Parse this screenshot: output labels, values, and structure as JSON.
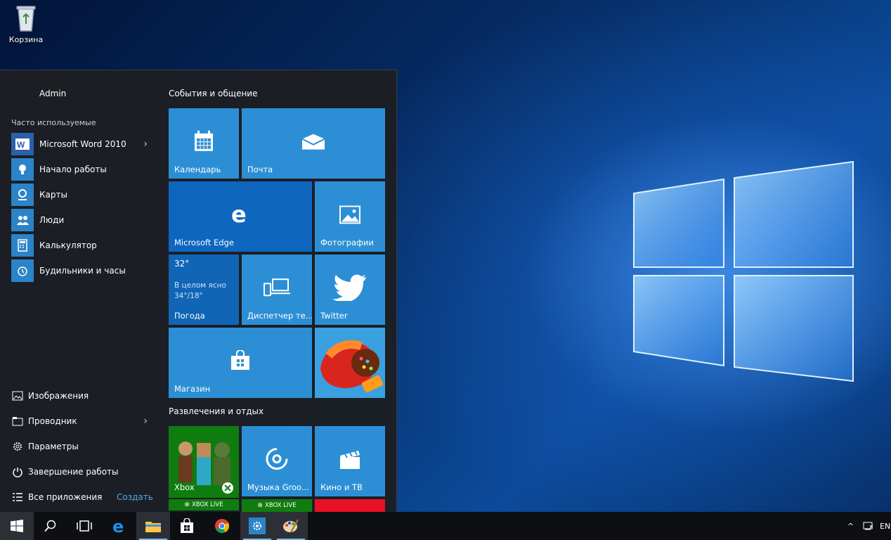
{
  "desktop": {
    "recycle_bin_label": "Корзина"
  },
  "start_menu": {
    "user_name": "Admin",
    "most_used_label": "Часто используемые",
    "apps": [
      {
        "label": "Microsoft Word 2010",
        "icon": "word-icon",
        "has_arrow": true
      },
      {
        "label": "Начало работы",
        "icon": "lightbulb-icon"
      },
      {
        "label": "Карты",
        "icon": "maps-icon"
      },
      {
        "label": "Люди",
        "icon": "people-icon"
      },
      {
        "label": "Калькулятор",
        "icon": "calculator-icon"
      },
      {
        "label": "Будильники и часы",
        "icon": "alarm-clock-icon"
      }
    ],
    "system": [
      {
        "label": "Изображения",
        "icon": "pictures-icon"
      },
      {
        "label": "Проводник",
        "icon": "file-explorer-icon",
        "has_arrow": true
      },
      {
        "label": "Параметры",
        "icon": "gear-icon"
      },
      {
        "label": "Завершение работы",
        "icon": "power-icon"
      },
      {
        "label": "Все приложения",
        "icon": "all-apps-icon"
      }
    ],
    "create_label": "Создать",
    "groups": {
      "life": "События и общение",
      "play": "Развлечения и отдых"
    },
    "tiles": {
      "calendar": "Календарь",
      "mail": "Почта",
      "edge": "Microsoft Edge",
      "photos": "Фотографии",
      "weather_temp": "32°",
      "weather_desc": "В целом ясно",
      "weather_range": "34°/18°",
      "weather": "Погода",
      "phone": "Диспетчер те...",
      "twitter": "Twitter",
      "store": "Магазин",
      "xbox": "Xbox",
      "music": "Музыка Groo...",
      "movies": "Кино и ТВ",
      "xbox_live_1": "XBOX LIVE",
      "xbox_live_2": "XBOX LIVE"
    }
  },
  "taskbar": {
    "language": "EN"
  },
  "colors": {
    "tile_blue": "#2c8fd5",
    "tile_dark_blue": "#0e66bf",
    "xbox_green": "#107c10",
    "accent_link": "#5aa7e8"
  }
}
